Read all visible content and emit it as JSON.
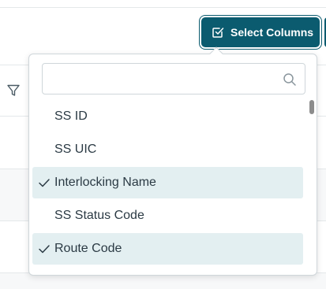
{
  "toolbar": {
    "select_columns_label": "Select Columns"
  },
  "column_picker": {
    "search": {
      "value": "",
      "placeholder": ""
    },
    "columns": [
      {
        "label": "SS ID",
        "selected": false
      },
      {
        "label": "SS UIC",
        "selected": false
      },
      {
        "label": "Interlocking Name",
        "selected": true
      },
      {
        "label": "SS Status Code",
        "selected": false
      },
      {
        "label": "Route Code",
        "selected": true
      }
    ]
  },
  "icons": {
    "select_columns": "checkbox-icon",
    "filter": "filter-icon",
    "search": "search-icon",
    "check": "check-icon"
  },
  "colors": {
    "primary": "#0b5b6f",
    "selected_row": "#e3eff1",
    "text": "#2b3a44"
  }
}
